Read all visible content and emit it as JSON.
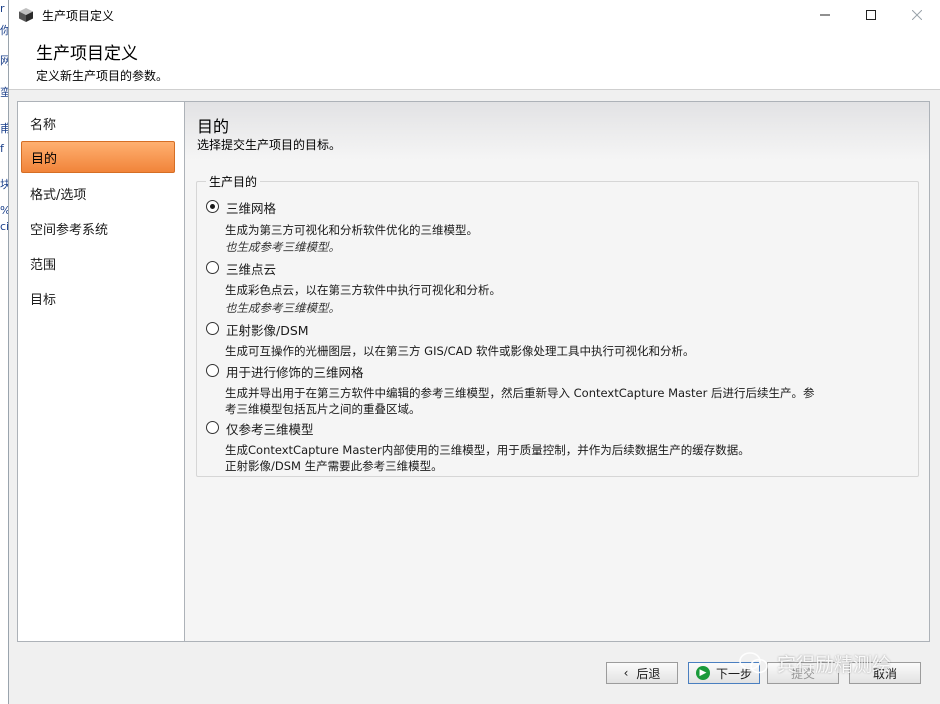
{
  "window": {
    "title": "生产项目定义"
  },
  "header": {
    "title": "生产项目定义",
    "subtitle": "定义新生产项目的参数。"
  },
  "sidebar": {
    "items": [
      {
        "label": "名称",
        "active": false
      },
      {
        "label": "目的",
        "active": true
      },
      {
        "label": "格式/选项",
        "active": false
      },
      {
        "label": "空间参考系统",
        "active": false
      },
      {
        "label": "范围",
        "active": false
      },
      {
        "label": "目标",
        "active": false
      }
    ]
  },
  "main": {
    "title": "目的",
    "subtitle": "选择提交生产项目的目标。",
    "group_label": "生产目的",
    "options": [
      {
        "label": "三维网格",
        "checked": true,
        "desc": "生成为第三方可视化和分析软件优化的三维模型。",
        "note": "也生成参考三维模型。"
      },
      {
        "label": "三维点云",
        "checked": false,
        "desc": "生成彩色点云，以在第三方软件中执行可视化和分析。",
        "note": "也生成参考三维模型。"
      },
      {
        "label": "正射影像/DSM",
        "checked": false,
        "desc": "生成可互操作的光栅图层，以在第三方 GIS/CAD 软件或影像处理工具中执行可视化和分析。"
      },
      {
        "label": "用于进行修饰的三维网格",
        "checked": false,
        "desc": "生成并导出用于在第三方软件中编辑的参考三维模型，然后重新导入 ContextCapture Master 后进行后续生产。参",
        "desc2": "考三维模型包括瓦片之间的重叠区域。"
      },
      {
        "label": "仅参考三维模型",
        "checked": false,
        "desc": "生成ContextCapture Master内部使用的三维模型，用于质量控制，并作为后续数据生产的缓存数据。",
        "desc2": "正射影像/DSM 生产需要此参考三维模型。"
      }
    ]
  },
  "footer": {
    "back": "后退",
    "next": "下一步",
    "submit": "提交",
    "cancel": "取消"
  },
  "watermark": "宾得励精测绘"
}
